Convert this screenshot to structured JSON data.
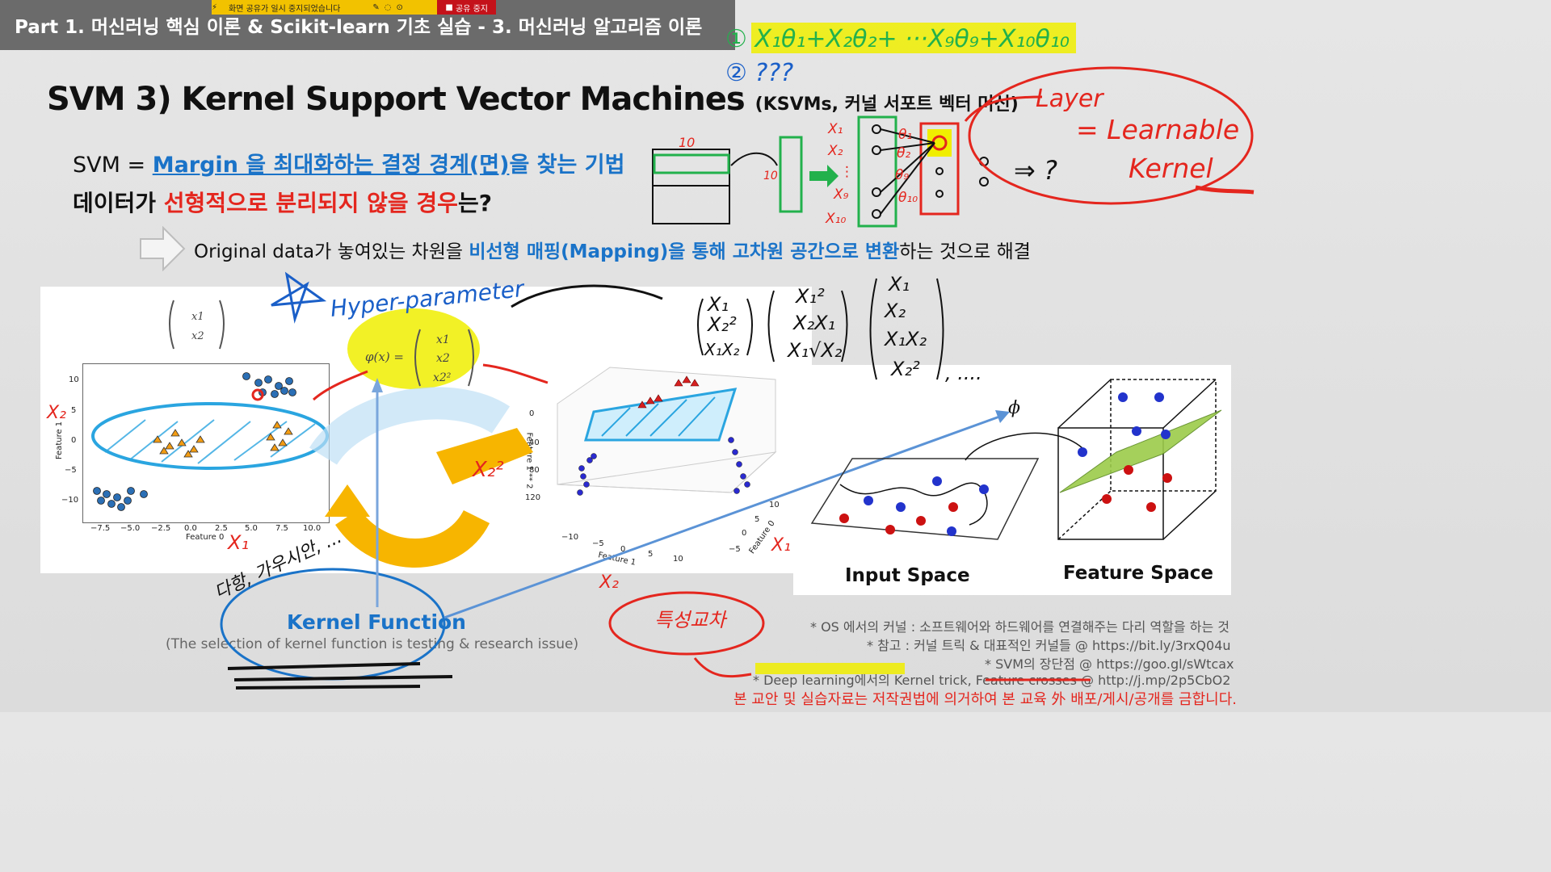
{
  "window": {
    "title": "Part 1. 머신러닝 핵심 이론 & Scikit-learn 기초 실습 - 3. 머신러닝 알고리즘 이론",
    "share_message": "화면 공유가 일시 중지되었습니다",
    "share_stop_label": "공유 중지"
  },
  "slide": {
    "title": "SVM 3) Kernel Support Vector Machines",
    "title_sub": "(KSVMs, 커널 서포트 벡터 머신)",
    "svm_prefix": "SVM = ",
    "svm_definition": "Margin 을 최대화하는 결정 경계(면)",
    "svm_suffix": "을 찾는 기법",
    "question_prefix": "데이터가 ",
    "question_red": "선형적으로 분리되지 않을 경우",
    "question_suffix": "는?",
    "solution_prefix": "Original data가 놓여있는 차원을 ",
    "solution_blue": "비선형 매핑(Mapping)을 통해 고차원 공간으로 변환",
    "solution_suffix": "하는 것으로 해결",
    "kernel_function_label": "Kernel Function",
    "kernel_function_note": "(The selection of kernel function is testing & research issue)",
    "input_space_label": "Input Space",
    "feature_space_label": "Feature Space",
    "notes": [
      "* OS 에서의 커널 : 소프트웨어와 하드웨어를 연결해주는 다리 역할을 하는 것",
      "* 참고 : 커널 트릭 & 대표적인 커널들 @ https://bit.ly/3rxQ04u",
      "* SVM의 장단점 @ https://goo.gl/sWtcax",
      "* Deep learning에서의 Kernel trick, Feature crosses @ http://j.mp/2p5CbO2"
    ],
    "copyright": "본 교안 및 실습자료는 저작권법에 의거하여 본 교육 外 배포/게시/공개를 금합니다."
  },
  "plot2d": {
    "xlabel": "Feature 0",
    "ylabel": "Feature 1",
    "xticks": [
      "−7.5",
      "−5.0",
      "−2.5",
      "0.0",
      "2.5",
      "5.0",
      "7.5",
      "10.0"
    ],
    "yticks": [
      "10",
      "5",
      "0",
      "−5",
      "−10"
    ]
  },
  "plot3d": {
    "zlabel": "Feature 1 ** 2",
    "zticks": [
      "0",
      "40",
      "80",
      "120"
    ],
    "xlabel": "Feature 1",
    "xticks": [
      "−10",
      "−5",
      "0",
      "5",
      "10"
    ],
    "ylabel": "Feature 0",
    "yticks": [
      "−5",
      "0",
      "5",
      "10"
    ]
  },
  "formulas": {
    "x_vector": [
      "x1",
      "x2"
    ],
    "phi_label": "φ(x) =",
    "phi_vector": [
      "x1",
      "x2",
      "x2²"
    ],
    "phi_symbol": "ϕ"
  },
  "handwriting": {
    "eq1": "① X₁θ₁+X₂θ₂+ ···X₉θ₉+X₁₀θ₁₀",
    "eq2": "② ???",
    "layer": "Layer",
    "learnable": "= Learnable",
    "kernel": "Kernel",
    "arrow_q": "⇒ ?",
    "hyper": "Hyper-parameter",
    "x2_left": "X₂",
    "x1_left": "X₁",
    "x2sq": "X₂²",
    "x1_right": "X₁",
    "x2_bottom": "X₂",
    "vec_a": [
      "X₁",
      "X₂²",
      "X₁X₂"
    ],
    "vec_b": [
      "X₁²",
      "X₂X₁",
      "X₁√X₂"
    ],
    "vec_c": [
      "X₁",
      "X₂",
      "X₁X₂",
      "X₂²"
    ],
    "ellipsis": ", ....",
    "korean_note": "특성교차",
    "star_note": "다항, 가우시안, ...",
    "net_10": "10",
    "net_inputs": [
      "X₁",
      "X₂",
      "⋮",
      "X₉",
      "X₁₀"
    ],
    "net_weights": [
      "θ₁",
      "θ₂",
      "θ₉",
      "θ₁₀"
    ]
  },
  "colors": {
    "accent_blue": "#1a73c8",
    "accent_red": "#e4261e",
    "ink_green": "#22b14c",
    "ink_cyan": "#2aa5e0",
    "highlight_yellow": "#f0ee00",
    "ink_orange": "#f7b500"
  }
}
